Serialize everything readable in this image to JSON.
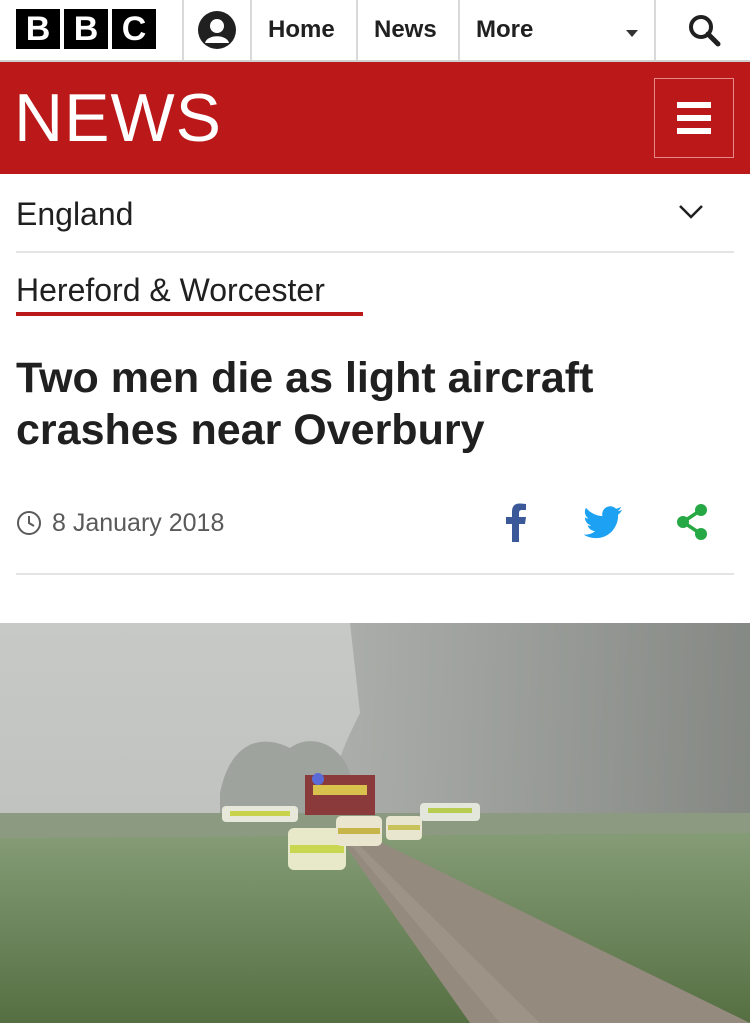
{
  "header": {
    "logo_letters": [
      "B",
      "B",
      "C"
    ],
    "account_icon": "account-icon",
    "nav": [
      {
        "label": "Home"
      },
      {
        "label": "News"
      },
      {
        "label": "More"
      }
    ],
    "search_icon": "search-icon"
  },
  "brand": {
    "title": "NEWS",
    "menu_icon": "hamburger-menu-icon",
    "color": "#bb1919"
  },
  "section": {
    "label": "England",
    "chevron_icon": "chevron-down-icon"
  },
  "subsection": {
    "label": "Hereford & Worcester"
  },
  "article": {
    "headline": "Two men die as light aircraft crashes near Overbury",
    "date": "8 January 2018",
    "clock_icon": "clock-icon",
    "share": [
      {
        "icon": "facebook-icon",
        "color": "#3b5998"
      },
      {
        "icon": "twitter-icon",
        "color": "#1da1f2"
      },
      {
        "icon": "share-icon",
        "color": "#26a844"
      }
    ],
    "image_icon": "aircraft-crash-scene-photo"
  }
}
